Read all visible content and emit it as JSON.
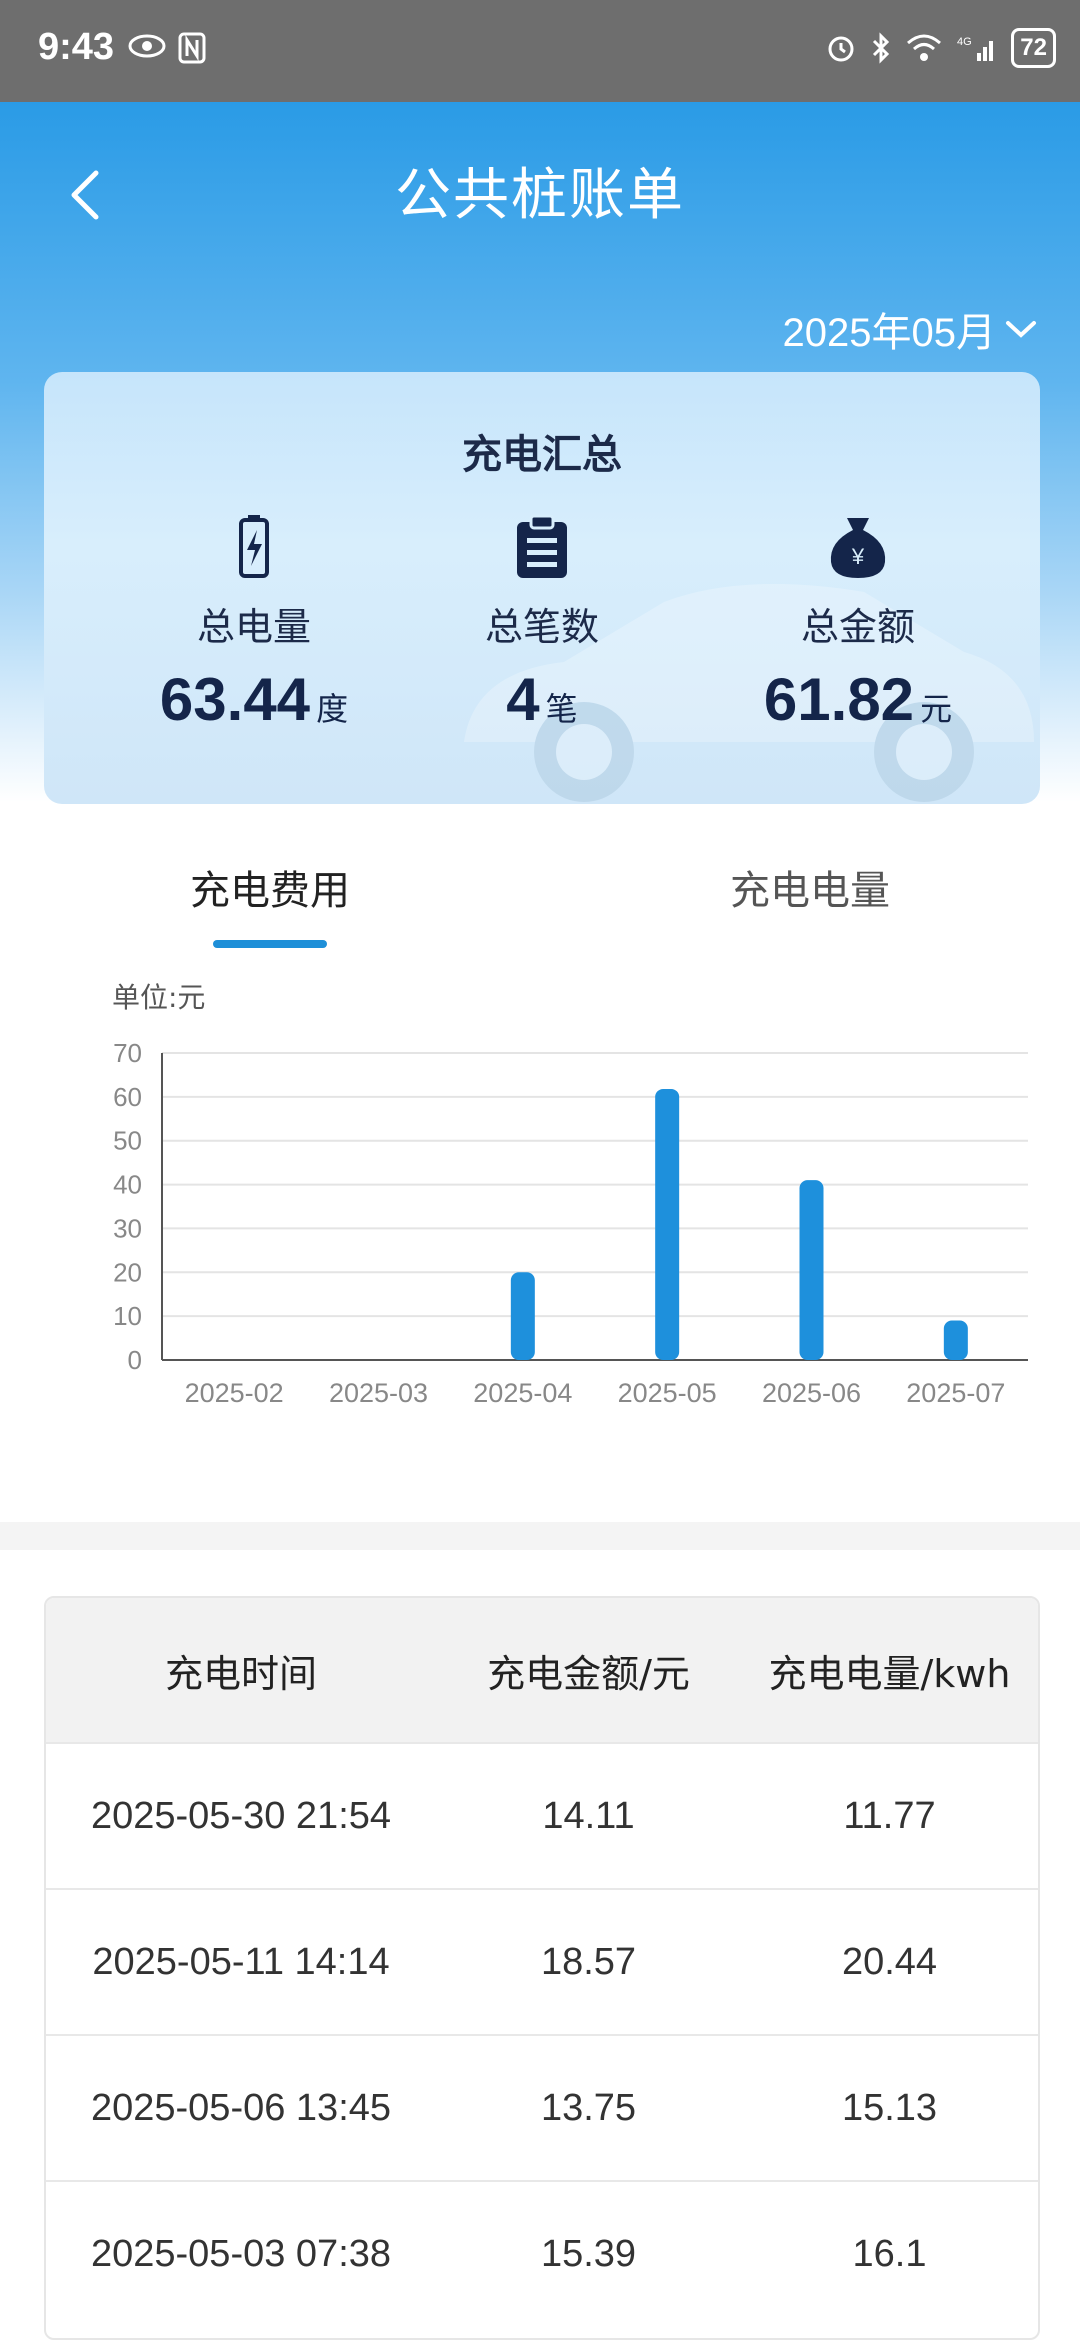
{
  "status_bar": {
    "time": "9:43",
    "battery": "72"
  },
  "header": {
    "title": "公共桩账单",
    "month": "2025年05月"
  },
  "summary": {
    "title": "充电汇总",
    "stats": [
      {
        "label": "总电量",
        "value": "63.44",
        "unit": "度"
      },
      {
        "label": "总笔数",
        "value": "4",
        "unit": "笔"
      },
      {
        "label": "总金额",
        "value": "61.82",
        "unit": "元"
      }
    ]
  },
  "tabs": [
    {
      "label": "充电费用",
      "active": true
    },
    {
      "label": "充电电量",
      "active": false
    }
  ],
  "chart_data": {
    "type": "bar",
    "unit_label": "单位:元",
    "categories": [
      "2025-02",
      "2025-03",
      "2025-04",
      "2025-05",
      "2025-06",
      "2025-07"
    ],
    "values": [
      0,
      0,
      20,
      61.8,
      41,
      9
    ],
    "ylim": [
      0,
      70
    ],
    "yticks": [
      0,
      10,
      20,
      30,
      40,
      50,
      60,
      70
    ],
    "bar_color": "#1e90dc",
    "grid": true
  },
  "table": {
    "headers": [
      "充电时间",
      "充电金额/元",
      "充电电量/kwh"
    ],
    "rows": [
      [
        "2025-05-30 21:54",
        "14.11",
        "11.77"
      ],
      [
        "2025-05-11 14:14",
        "18.57",
        "20.44"
      ],
      [
        "2025-05-06 13:45",
        "13.75",
        "15.13"
      ],
      [
        "2025-05-03 07:38",
        "15.39",
        "16.1"
      ]
    ]
  }
}
